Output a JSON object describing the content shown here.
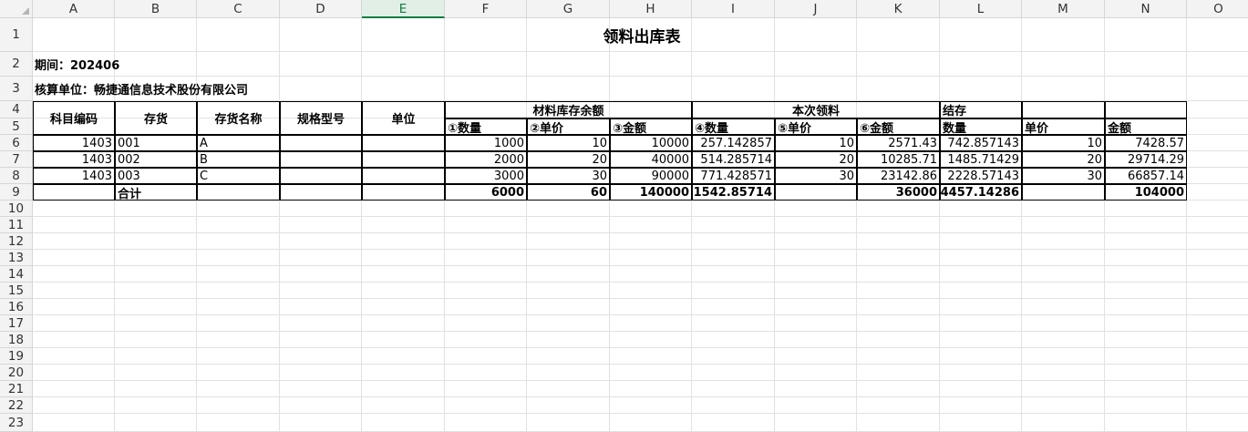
{
  "columns": [
    "A",
    "B",
    "C",
    "D",
    "E",
    "F",
    "G",
    "H",
    "I",
    "J",
    "K",
    "L",
    "M",
    "N",
    "O"
  ],
  "selected_column": "E",
  "rows": [
    "1",
    "2",
    "3",
    "4",
    "5",
    "6",
    "7",
    "8",
    "9",
    "10",
    "11",
    "12",
    "13",
    "14",
    "15",
    "16",
    "17",
    "18",
    "19",
    "20",
    "21",
    "22",
    "23"
  ],
  "sheet": {
    "title": "领料出库表",
    "period": "期间：202406",
    "unit": "核算单位：畅捷通信息技术股份有限公司",
    "headers": {
      "subject_code": "科目编码",
      "inventory": "存货",
      "inventory_name": "存货名称",
      "spec": "规格型号",
      "unit": "单位",
      "group1": "材料库存余额",
      "group2": "本次领料",
      "group3": "结存",
      "qty1": "①数量",
      "price1": "②单价",
      "amount1": "③金额",
      "qty2": "④数量",
      "price2": "⑤单价",
      "amount2": "⑥金额",
      "qty3": "数量",
      "price3": "单价",
      "amount3": "金额"
    },
    "data_rows": [
      {
        "code": "1403",
        "inv": "001",
        "name": "A",
        "q1": "1000",
        "p1": "10",
        "a1": "10000",
        "q2": "257.142857",
        "p2": "10",
        "a2": "2571.43",
        "q3": "742.857143",
        "p3": "10",
        "a3": "7428.57"
      },
      {
        "code": "1403",
        "inv": "002",
        "name": "B",
        "q1": "2000",
        "p1": "20",
        "a1": "40000",
        "q2": "514.285714",
        "p2": "20",
        "a2": "10285.71",
        "q3": "1485.71429",
        "p3": "20",
        "a3": "29714.29"
      },
      {
        "code": "1403",
        "inv": "003",
        "name": "C",
        "q1": "3000",
        "p1": "30",
        "a1": "90000",
        "q2": "771.428571",
        "p2": "30",
        "a2": "23142.86",
        "q3": "2228.57143",
        "p3": "30",
        "a3": "66857.14"
      }
    ],
    "total": {
      "label": "合计",
      "q1": "6000",
      "p1": "60",
      "a1": "140000",
      "q2": "1542.85714",
      "a2": "36000",
      "q3": "4457.14286",
      "a3": "104000"
    }
  }
}
